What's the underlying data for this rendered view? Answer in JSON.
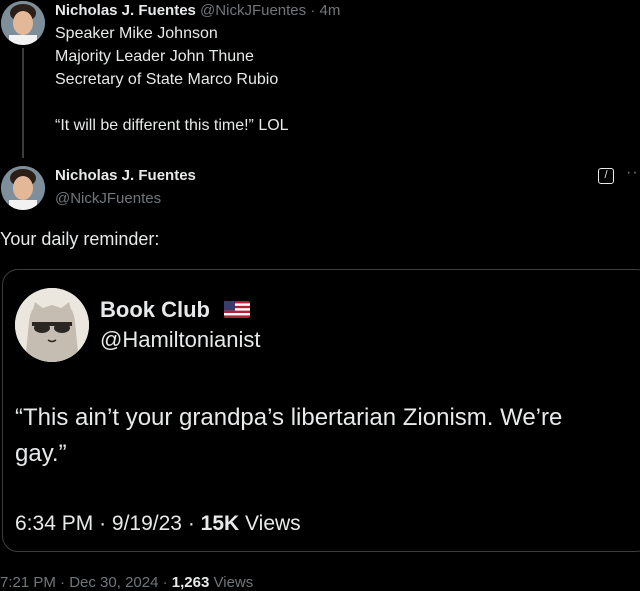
{
  "reply": {
    "author_name": "Nicholas J. Fuentes",
    "author_handle": "@NickJFuentes",
    "separator": "·",
    "time_ago": "4m",
    "lines": [
      "Speaker Mike Johnson",
      "Majority Leader John Thune",
      "Secretary of State Marco Rubio"
    ],
    "closing": "“It will be different this time!” LOL"
  },
  "post": {
    "author_name": "Nicholas J. Fuentes",
    "author_handle": "@NickJFuentes",
    "edit_icon": "edit-icon",
    "more_icon": "more-icon",
    "more_glyph": "··",
    "text": "Your daily reminder:"
  },
  "quoted": {
    "author_name": "Book Club",
    "flag_icon": "us-flag-icon",
    "author_handle": "@Hamiltonianist",
    "text": "“This ain’t your grandpa’s libertarian Zionism. We’re gay.”",
    "time": "6:34 PM",
    "sep": "·",
    "date": "9/19/23",
    "views_count": "15K",
    "views_label": "Views"
  },
  "footer": {
    "time": "7:21 PM",
    "sep": "·",
    "date": "Dec 30, 2024",
    "views_count": "1,263",
    "views_label": "Views"
  },
  "colors": {
    "background": "#000000",
    "text": "#e7e9ea",
    "muted": "#71767b",
    "border": "#3a3d40"
  }
}
